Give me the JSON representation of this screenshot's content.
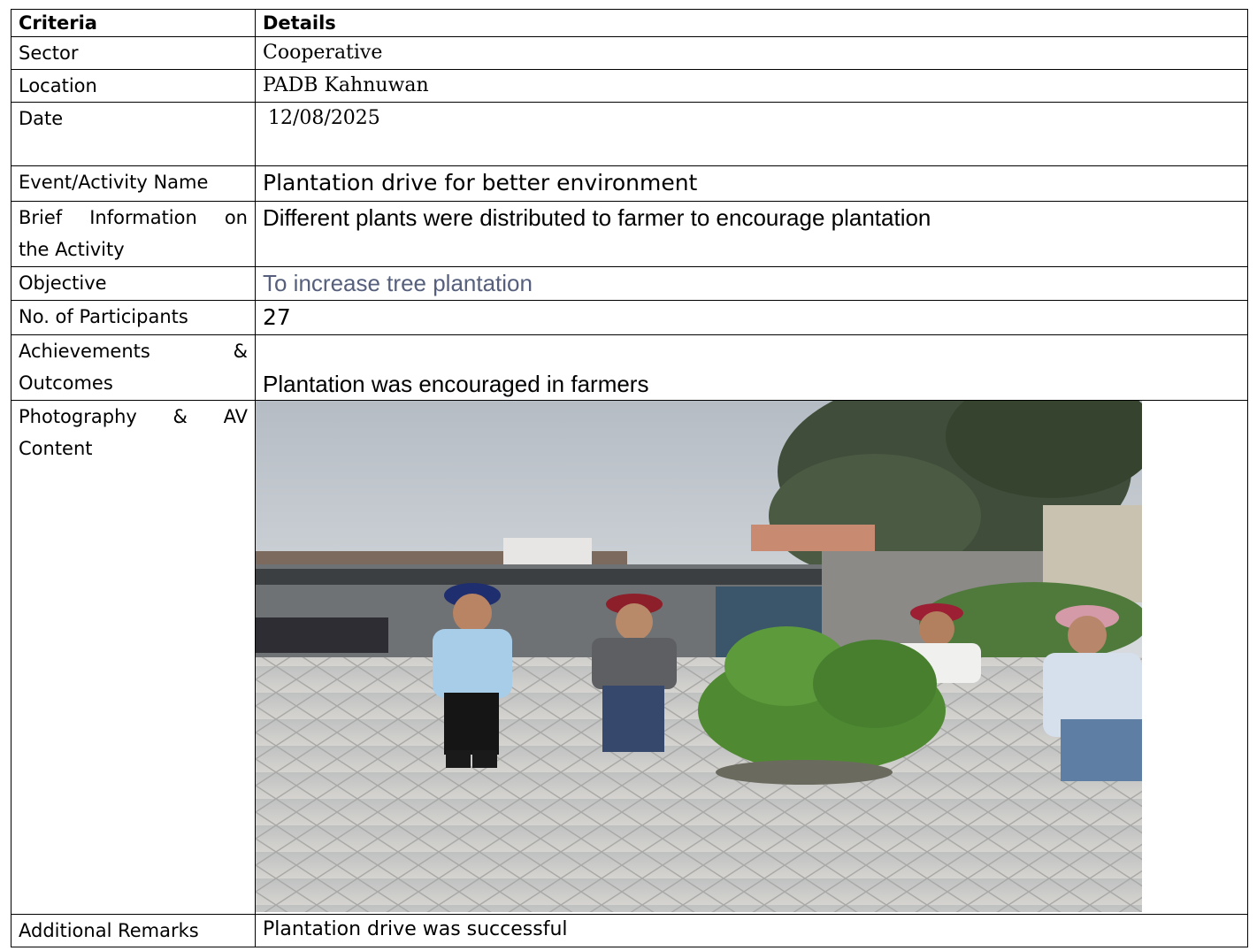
{
  "headers": {
    "criteria": "Criteria",
    "details": "Details"
  },
  "rows": {
    "sector": {
      "label": "Sector",
      "value": "Cooperative"
    },
    "location": {
      "label": "Location",
      "value": "PADB Kahnuwan"
    },
    "date": {
      "label": "Date",
      "value": "12/08/2025"
    },
    "event": {
      "label": "Event/Activity Name",
      "value": "Plantation drive for better environment"
    },
    "brief": {
      "label_line1": "Brief Information on",
      "label_line2": "the Activity",
      "value": "Different plants were distributed to farmer to encourage plantation"
    },
    "objective": {
      "label": "Objective",
      "value": "To increase tree plantation"
    },
    "participants": {
      "label": "No. of Participants",
      "value": "27"
    },
    "achievements": {
      "label_line1": "Achievements &",
      "label_line2": "Outcomes",
      "value": "Plantation was encouraged in farmers"
    },
    "photography": {
      "label_line1": "Photography & AV",
      "label_line2": "Content"
    },
    "remarks": {
      "label": "Additional Remarks",
      "value": "Plantation drive was successful"
    }
  },
  "colors": {
    "border": "#000000",
    "objective_text": "#56607d"
  }
}
